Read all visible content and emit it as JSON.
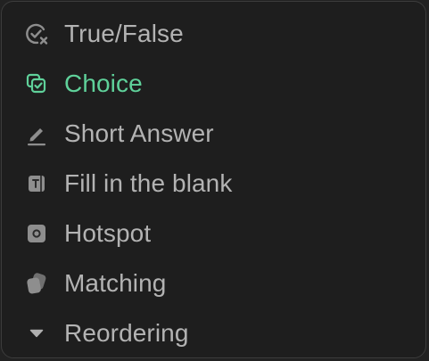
{
  "menu": {
    "items": [
      {
        "label": "True/False",
        "icon": "check-circle-x-icon",
        "active": false
      },
      {
        "label": "Choice",
        "icon": "choice-copy-check-icon",
        "active": true
      },
      {
        "label": "Short Answer",
        "icon": "pen-line-icon",
        "active": false
      },
      {
        "label": "Fill in the blank",
        "icon": "text-field-icon",
        "active": false
      },
      {
        "label": "Hotspot",
        "icon": "hotspot-icon",
        "active": false
      },
      {
        "label": "Matching",
        "icon": "matching-cards-icon",
        "active": false
      },
      {
        "label": "Reordering",
        "icon": "caret-down-icon",
        "active": false
      }
    ]
  },
  "colors": {
    "active": "#5fd19a",
    "label": "#b3b3b3",
    "icon": "#8e8e8e",
    "border": "#3c3c3c"
  }
}
